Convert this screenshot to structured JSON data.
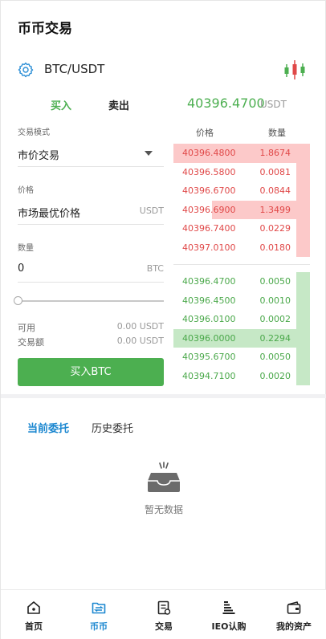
{
  "header": {
    "title": "币币交易"
  },
  "pair": {
    "name": "BTC/USDT",
    "gear_icon": "gear-icon",
    "chart_icon": "candlestick-icon"
  },
  "trade_tabs": {
    "buy": "买入",
    "sell": "卖出"
  },
  "ticker": {
    "last_price": "40396.4700",
    "unit": "USDT"
  },
  "form": {
    "mode_label": "交易模式",
    "mode_value": "市价交易",
    "price_label": "价格",
    "price_value": "市场最优价格",
    "price_unit": "USDT",
    "amount_label": "数量",
    "amount_value": "0",
    "amount_unit": "BTC",
    "slider_percent": 0,
    "available_label": "可用",
    "available_value": "0.00 USDT",
    "volume_label": "交易额",
    "volume_value": "0.00 USDT",
    "submit_label": "买入BTC"
  },
  "orderbook": {
    "header_price": "价格",
    "header_qty": "数量",
    "asks": [
      {
        "price": "40396.4800",
        "qty": "1.8674",
        "depth": 1.0
      },
      {
        "price": "40396.5800",
        "qty": "0.0081",
        "depth": 0.1
      },
      {
        "price": "40396.6700",
        "qty": "0.0844",
        "depth": 0.1
      },
      {
        "price": "40396.6900",
        "qty": "1.3499",
        "depth": 0.72
      },
      {
        "price": "40396.7400",
        "qty": "0.0229",
        "depth": 0.1
      },
      {
        "price": "40397.0100",
        "qty": "0.0180",
        "depth": 0.1
      }
    ],
    "bids": [
      {
        "price": "40396.4700",
        "qty": "0.0050",
        "depth": 0.1
      },
      {
        "price": "40396.4500",
        "qty": "0.0010",
        "depth": 0.1
      },
      {
        "price": "40396.0100",
        "qty": "0.0002",
        "depth": 0.1
      },
      {
        "price": "40396.0000",
        "qty": "0.2294",
        "depth": 1.0
      },
      {
        "price": "40395.6700",
        "qty": "0.0050",
        "depth": 0.1
      },
      {
        "price": "40394.7100",
        "qty": "0.0020",
        "depth": 0.1
      }
    ],
    "colors": {
      "ask": "#e04848",
      "bid": "#4aa84a"
    }
  },
  "orders": {
    "tab_current": "当前委托",
    "tab_history": "历史委托",
    "empty_icon": "empty-inbox-icon",
    "empty_text": "暂无数据"
  },
  "tabbar": {
    "items": [
      {
        "label": "首页",
        "icon": "home-icon",
        "active": false
      },
      {
        "label": "币币",
        "icon": "exchange-icon",
        "active": true
      },
      {
        "label": "交易",
        "icon": "trade-doc-icon",
        "active": false
      },
      {
        "label": "IEO认购",
        "icon": "ieo-icon",
        "active": false
      },
      {
        "label": "我的资产",
        "icon": "wallet-icon",
        "active": false
      }
    ],
    "accent": "#1b87d0"
  }
}
